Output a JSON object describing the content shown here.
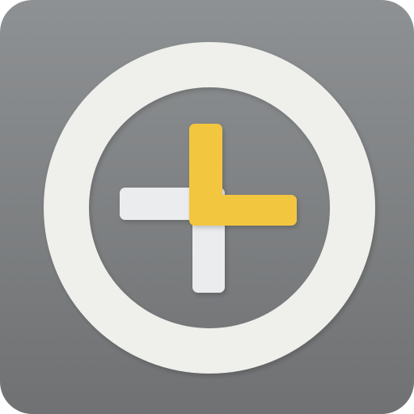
{
  "app_icon": {
    "icon_name": "clock-plus-icon",
    "colors": {
      "tile_top": "#8e9193",
      "tile_bottom": "#6f7173",
      "ring": "#efefeb",
      "ring_shadow": "#d9d9d4",
      "cross": "#ebecee",
      "cross_shadow": "#c7c8cb",
      "hands": "#f3c63f",
      "hands_shadow": "#d9ab25"
    }
  }
}
